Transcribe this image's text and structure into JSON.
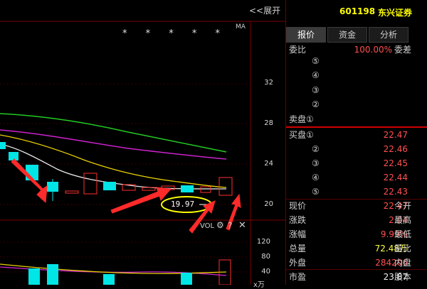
{
  "chart": {
    "expand_label": "<<展开",
    "ma_label": "MA",
    "ma_stars": "* * * * *",
    "price_axis": [
      "32",
      "28",
      "24",
      "20"
    ],
    "volume_axis": [
      "120",
      "80",
      "40"
    ],
    "volume_unit": "x万",
    "callout_price": "19.97",
    "vol_label": "VOL"
  },
  "panel": {
    "code": "601198",
    "name": "东兴证券",
    "tabs": [
      "报价",
      "资金",
      "分析"
    ],
    "active_tab": 0,
    "ratio_label": "委比",
    "ratio_value": "100.00%",
    "diff_label": "委差",
    "sell_levels": [
      "⑤",
      "④",
      "③",
      "②",
      "卖盘①"
    ],
    "buy_levels": [
      {
        "label": "买盘①",
        "price": "22.47"
      },
      {
        "label": "②",
        "price": "22.46"
      },
      {
        "label": "③",
        "price": "22.45"
      },
      {
        "label": "④",
        "price": "22.44"
      },
      {
        "label": "⑤",
        "price": "22.43"
      }
    ],
    "stats": [
      {
        "label": "现价",
        "value": "22.47",
        "right": "今开"
      },
      {
        "label": "涨跌",
        "value": "2.04",
        "right": "最高"
      },
      {
        "label": "涨幅",
        "value": "9.99%",
        "right": "最低"
      },
      {
        "label": "总量",
        "value": "72.48万",
        "right": "量比"
      },
      {
        "label": "外盘",
        "value": "284206",
        "right": "内盘"
      },
      {
        "label": "市盈",
        "value": "23.87",
        "right": "股本"
      }
    ]
  },
  "colors": {
    "up": "#ff5050",
    "down": "#00e5e5",
    "ma5": "#e8e8e8",
    "ma10": "#e8d000",
    "ma20": "#cc22cc",
    "ma30": "#22cc22",
    "highlight": "#ffff00",
    "arrow": "#ff2a2a"
  }
}
